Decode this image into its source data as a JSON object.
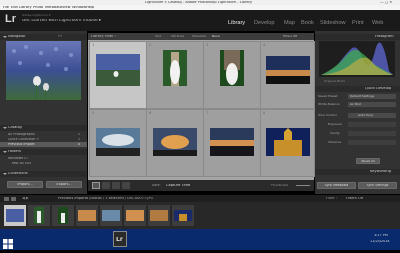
{
  "window": {
    "title": "Lightroom 5 Catalog - Adobe Photoshop Lightroom - Library"
  },
  "menu": [
    "File",
    "Edit",
    "Library",
    "Photo",
    "Metadata",
    "View",
    "Window",
    "Help"
  ],
  "identity": {
    "logo": "Lr",
    "line1": "Adobe Lightroom 5",
    "line2": "Get started with Lightroom mobile ▸"
  },
  "modules": [
    "Library",
    "Develop",
    "Map",
    "Book",
    "Slideshow",
    "Print",
    "Web"
  ],
  "active_module": "Library",
  "navigator": {
    "title": "Navigator",
    "zoom_options": [
      "FIT",
      "FILL",
      "1:1",
      "3:1"
    ]
  },
  "catalog": {
    "title": "Catalog",
    "items": [
      {
        "label": "All Photographs",
        "count": "5"
      },
      {
        "label": "Quick Collection +",
        "count": "0"
      },
      {
        "label": "Previous Import",
        "count": "8"
      }
    ]
  },
  "folders": {
    "title": "Folders",
    "items": [
      {
        "label": "Windows C:",
        "count": ""
      },
      {
        "label": "test all 543",
        "count": ""
      }
    ]
  },
  "collections": {
    "title": "Collections"
  },
  "left_buttons": {
    "import": "Import...",
    "export": "Export..."
  },
  "library_filter": {
    "title": "Library Filter :",
    "tabs": [
      "Text",
      "Attribute",
      "Metadata",
      "None"
    ],
    "preset": "Filters Off"
  },
  "grid": {
    "rows": [
      {
        "cells": [
          {
            "num": "1",
            "photo": "Flower field"
          },
          {
            "num": "2",
            "photo": "Bride standing"
          },
          {
            "num": "3",
            "photo": "Bride on steps"
          },
          {
            "num": "4",
            "photo": "Sunset sky"
          }
        ]
      },
      {
        "cells": [
          {
            "num": "5",
            "photo": "Cloudy skyline"
          },
          {
            "num": "6",
            "photo": "Orange sunset"
          },
          {
            "num": "7",
            "photo": "Sunset horizon"
          },
          {
            "num": "8",
            "photo": "Church at night"
          }
        ]
      }
    ]
  },
  "toolbar": {
    "sort_label": "Sort:",
    "sort_value": "Capture Time",
    "thumbnails_label": "Thumbnails"
  },
  "right_panel": {
    "histogram_title": "Histogram",
    "original_photo": "Original Photo",
    "quick_develop": {
      "title": "Quick Develop",
      "rows": [
        {
          "label": "Saved Preset",
          "value": "Default Settings"
        },
        {
          "label": "White Balance",
          "value": "As Shot"
        },
        {
          "label": "Tone Control",
          "value": "Auto Tone"
        },
        {
          "label": "Exposure",
          "value": ""
        },
        {
          "label": "Clarity",
          "value": ""
        },
        {
          "label": "Vibrance",
          "value": ""
        }
      ],
      "reset_all": "Reset All"
    },
    "keywording_title": "Keywording",
    "sync_metadata": "Sync Metadata",
    "sync_settings": "Sync Settings"
  },
  "filmstrip": {
    "nav_label": "Previous Import",
    "selection_info": "8 photos / 1 selected / DSC00077.JPG",
    "filter_label": "Filter :",
    "filter_value": "Filters Off"
  },
  "taskbar": {
    "time": "3:27 PM",
    "date": "11/25/2014"
  },
  "colors": {
    "accent": "#ffffff",
    "panel": "#323232",
    "grid_bg": "#9f9f9f",
    "taskbar": "#0a2a6e"
  }
}
